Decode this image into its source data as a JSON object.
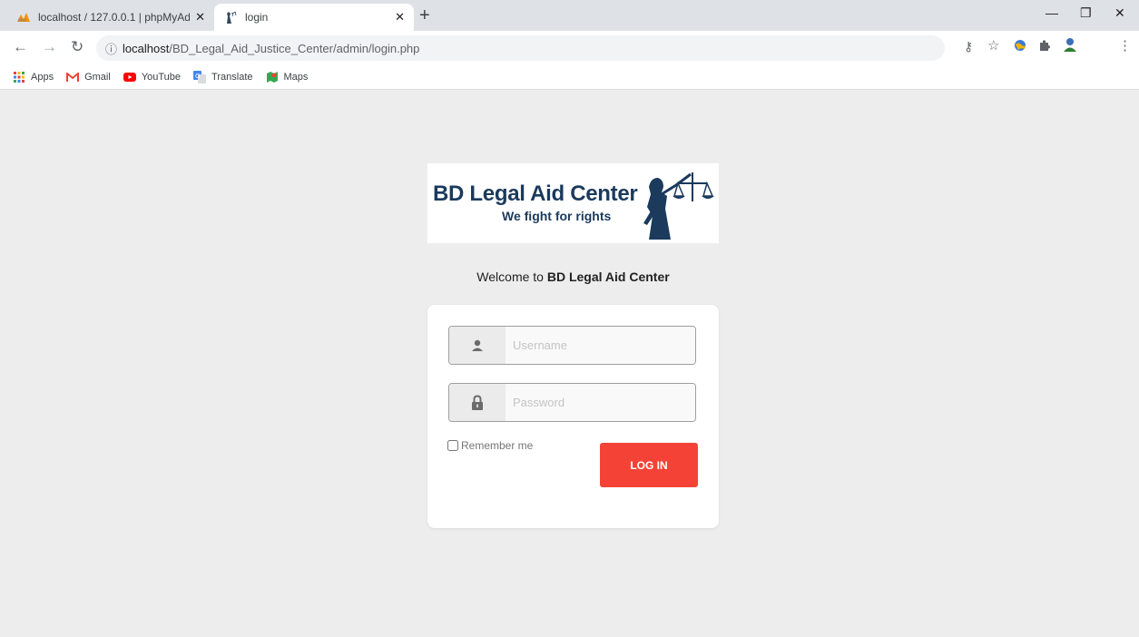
{
  "browser": {
    "tabs": [
      {
        "title": "localhost / 127.0.0.1 | phpMyAdm",
        "icon": "phpmyadmin-icon",
        "active": false
      },
      {
        "title": "login",
        "icon": "lady-justice-icon",
        "active": true
      }
    ],
    "url_host": "localhost",
    "url_path": "/BD_Legal_Aid_Justice_Center/admin/login.php",
    "bookmarks": [
      {
        "label": "Apps",
        "icon": "apps-grid-icon"
      },
      {
        "label": "Gmail",
        "icon": "gmail-icon"
      },
      {
        "label": "YouTube",
        "icon": "youtube-icon"
      },
      {
        "label": "Translate",
        "icon": "translate-icon"
      },
      {
        "label": "Maps",
        "icon": "maps-icon"
      }
    ]
  },
  "logo": {
    "name": "BD Legal Aid Center",
    "tagline": "We fight for rights"
  },
  "welcome": {
    "prefix": "Welcome to",
    "name": "BD Legal Aid Center"
  },
  "form": {
    "username_placeholder": "Username",
    "password_placeholder": "Password",
    "remember_label": "Remember me",
    "login_label": "LOG IN"
  },
  "colors": {
    "accent": "#f44336",
    "logo_text": "#1b3a5c",
    "background": "#ededed"
  }
}
